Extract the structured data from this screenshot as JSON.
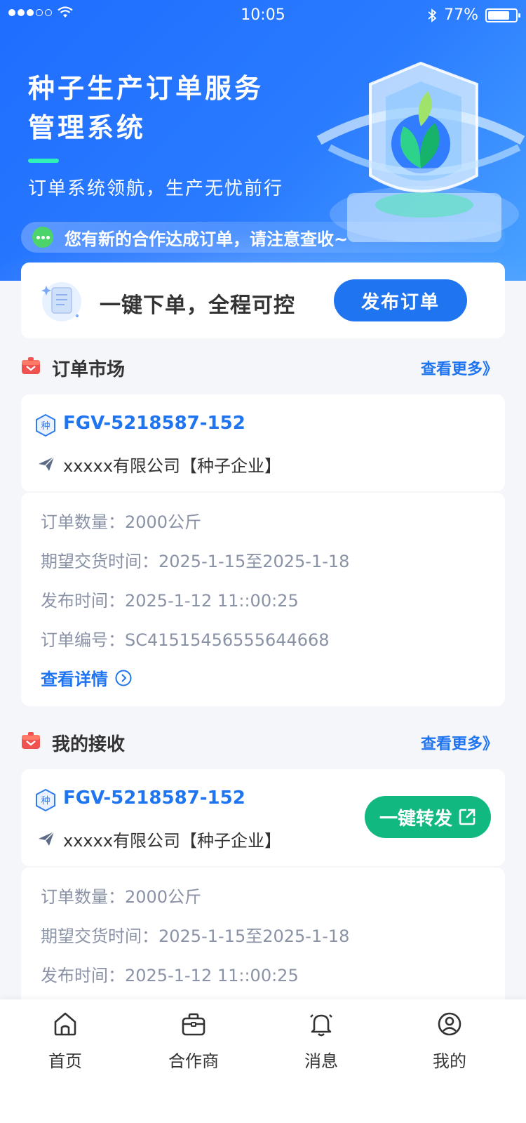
{
  "status_bar": {
    "time": "10:05",
    "battery": "77%"
  },
  "hero": {
    "title_line1": "种子生产订单服务",
    "title_line2": "管理系统",
    "subtitle": "订单系统领航，生产无忧前行",
    "notice": "您有新的合作达成订单，请注意查收~"
  },
  "publish": {
    "text": "一键下单，全程可控",
    "button": "发布订单"
  },
  "market": {
    "title": "订单市场",
    "more": "查看更多》",
    "order": {
      "code": "FGV-5218587-152",
      "company": "xxxxx有限公司【种子企业】",
      "quantity_label": "订单数量：",
      "quantity": "2000公斤",
      "delivery_label": "期望交货时间：",
      "delivery": "2025-1-15至2025-1-18",
      "publish_label": "发布时间：",
      "publish_time": "2025-1-12 11::00:25",
      "number_label": "订单编号：",
      "number": "SC41515456555644668",
      "detail_link": "查看详情"
    }
  },
  "received": {
    "title": "我的接收",
    "more": "查看更多》",
    "order": {
      "code": "FGV-5218587-152",
      "company": "xxxxx有限公司【种子企业】",
      "forward_button": "一键转发",
      "quantity_label": "订单数量：",
      "quantity": "2000公斤",
      "delivery_label": "期望交货时间：",
      "delivery": "2025-1-15至2025-1-18",
      "publish_label": "发布时间：",
      "publish_time": "2025-1-12 11::00:25"
    }
  },
  "tabs": [
    {
      "label": "首页",
      "icon": "home-icon"
    },
    {
      "label": "合作商",
      "icon": "briefcase-icon"
    },
    {
      "label": "消息",
      "icon": "bell-icon"
    },
    {
      "label": "我的",
      "icon": "user-icon"
    }
  ],
  "colors": {
    "primary": "#1f74f0",
    "green": "#11b981",
    "accent": "#2ef2b8"
  }
}
